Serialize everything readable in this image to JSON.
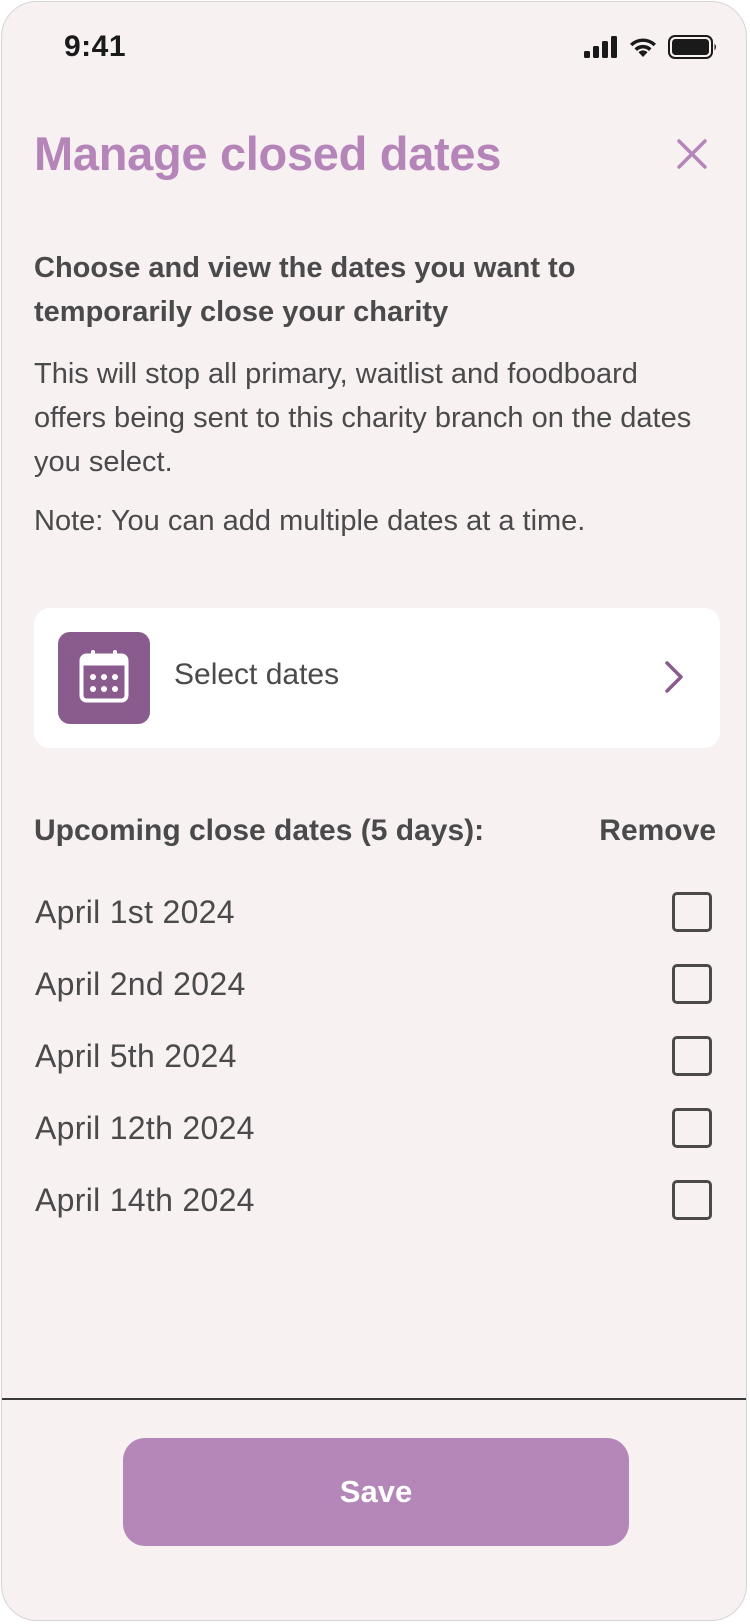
{
  "status_bar": {
    "time": "9:41",
    "icons": [
      "signal-icon",
      "wifi-icon",
      "battery-icon"
    ]
  },
  "header": {
    "title": "Manage closed dates",
    "close_icon": "close-icon"
  },
  "intro": {
    "heading": "Choose and view the dates you want to temporarily close your charity",
    "body": "This will stop all primary, waitlist and foodboard offers being sent to this charity branch on the dates you select.",
    "note": "Note: You can add multiple dates at a time."
  },
  "select_dates": {
    "label": "Select dates",
    "icon": "calendar-icon",
    "chevron_icon": "chevron-right-icon"
  },
  "upcoming": {
    "header": "Upcoming close dates (5 days):",
    "remove_label": "Remove",
    "dates": [
      {
        "label": "April 1st 2024",
        "checked": false
      },
      {
        "label": "April 2nd 2024",
        "checked": false
      },
      {
        "label": "April 5th 2024",
        "checked": false
      },
      {
        "label": "April 12th 2024",
        "checked": false
      },
      {
        "label": "April 14th 2024",
        "checked": false
      }
    ]
  },
  "footer": {
    "save_label": "Save"
  },
  "colors": {
    "accent": "#b585b9",
    "calendar_bg": "#8a5b8d",
    "button_bg": "#b487b8",
    "page_bg": "#f7f1f2",
    "text": "#4a4a4a"
  }
}
